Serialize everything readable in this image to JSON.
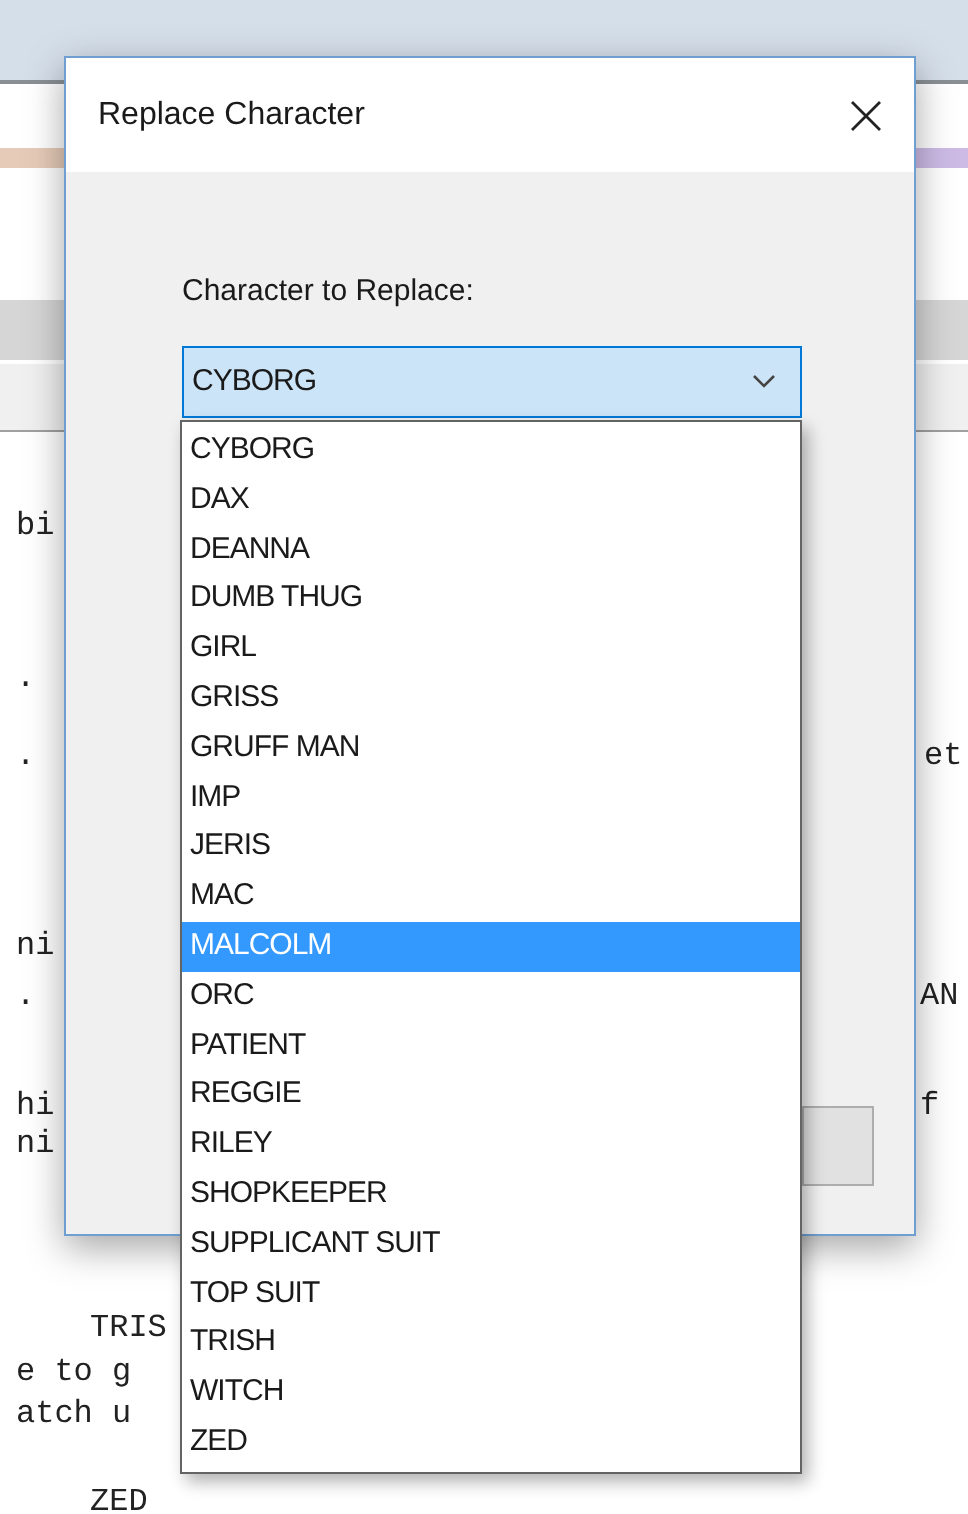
{
  "background_text": [
    "bi",
    ".",
    ".",
    "et",
    "ni",
    ".",
    "AN",
    "hi",
    "ni",
    "f",
    "TRIS",
    "e to g",
    "atch u",
    "ZED"
  ],
  "dialog": {
    "title": "Replace Character",
    "label": "Character to Replace:",
    "combobox": {
      "value": "CYBORG",
      "expanded": true
    },
    "options": [
      {
        "label": "CYBORG",
        "selected": false
      },
      {
        "label": "DAX",
        "selected": false
      },
      {
        "label": "DEANNA",
        "selected": false
      },
      {
        "label": "DUMB THUG",
        "selected": false
      },
      {
        "label": "GIRL",
        "selected": false
      },
      {
        "label": "GRISS",
        "selected": false
      },
      {
        "label": "GRUFF MAN",
        "selected": false
      },
      {
        "label": "IMP",
        "selected": false
      },
      {
        "label": "JERIS",
        "selected": false
      },
      {
        "label": "MAC",
        "selected": false
      },
      {
        "label": "MALCOLM",
        "selected": true
      },
      {
        "label": "ORC",
        "selected": false
      },
      {
        "label": "PATIENT",
        "selected": false
      },
      {
        "label": "REGGIE",
        "selected": false
      },
      {
        "label": "RILEY",
        "selected": false
      },
      {
        "label": "SHOPKEEPER",
        "selected": false
      },
      {
        "label": "SUPPLICANT SUIT",
        "selected": false
      },
      {
        "label": "TOP SUIT",
        "selected": false
      },
      {
        "label": "TRISH",
        "selected": false
      },
      {
        "label": "WITCH",
        "selected": false
      },
      {
        "label": "ZED",
        "selected": false
      }
    ]
  }
}
